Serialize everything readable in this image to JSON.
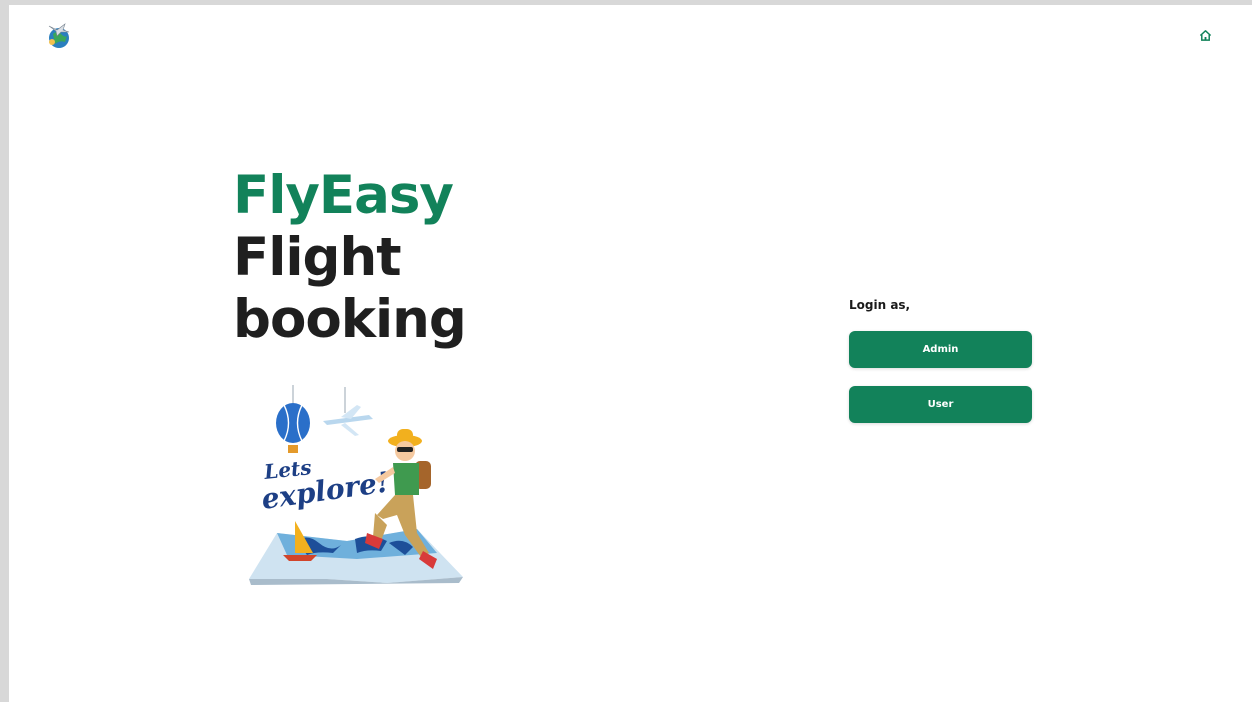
{
  "header": {
    "logo_icon": "globe-travel-logo-icon",
    "home_icon": "home-icon"
  },
  "hero": {
    "line1": "FlyEasy",
    "line2": "Flight",
    "line3": "booking",
    "illustration_text_1": "Lets",
    "illustration_text_2": "explore!"
  },
  "login": {
    "label": "Login as,",
    "admin_label": "Admin",
    "user_label": "User"
  },
  "colors": {
    "brand": "#12825a",
    "dark_text": "#1f1f1f"
  }
}
